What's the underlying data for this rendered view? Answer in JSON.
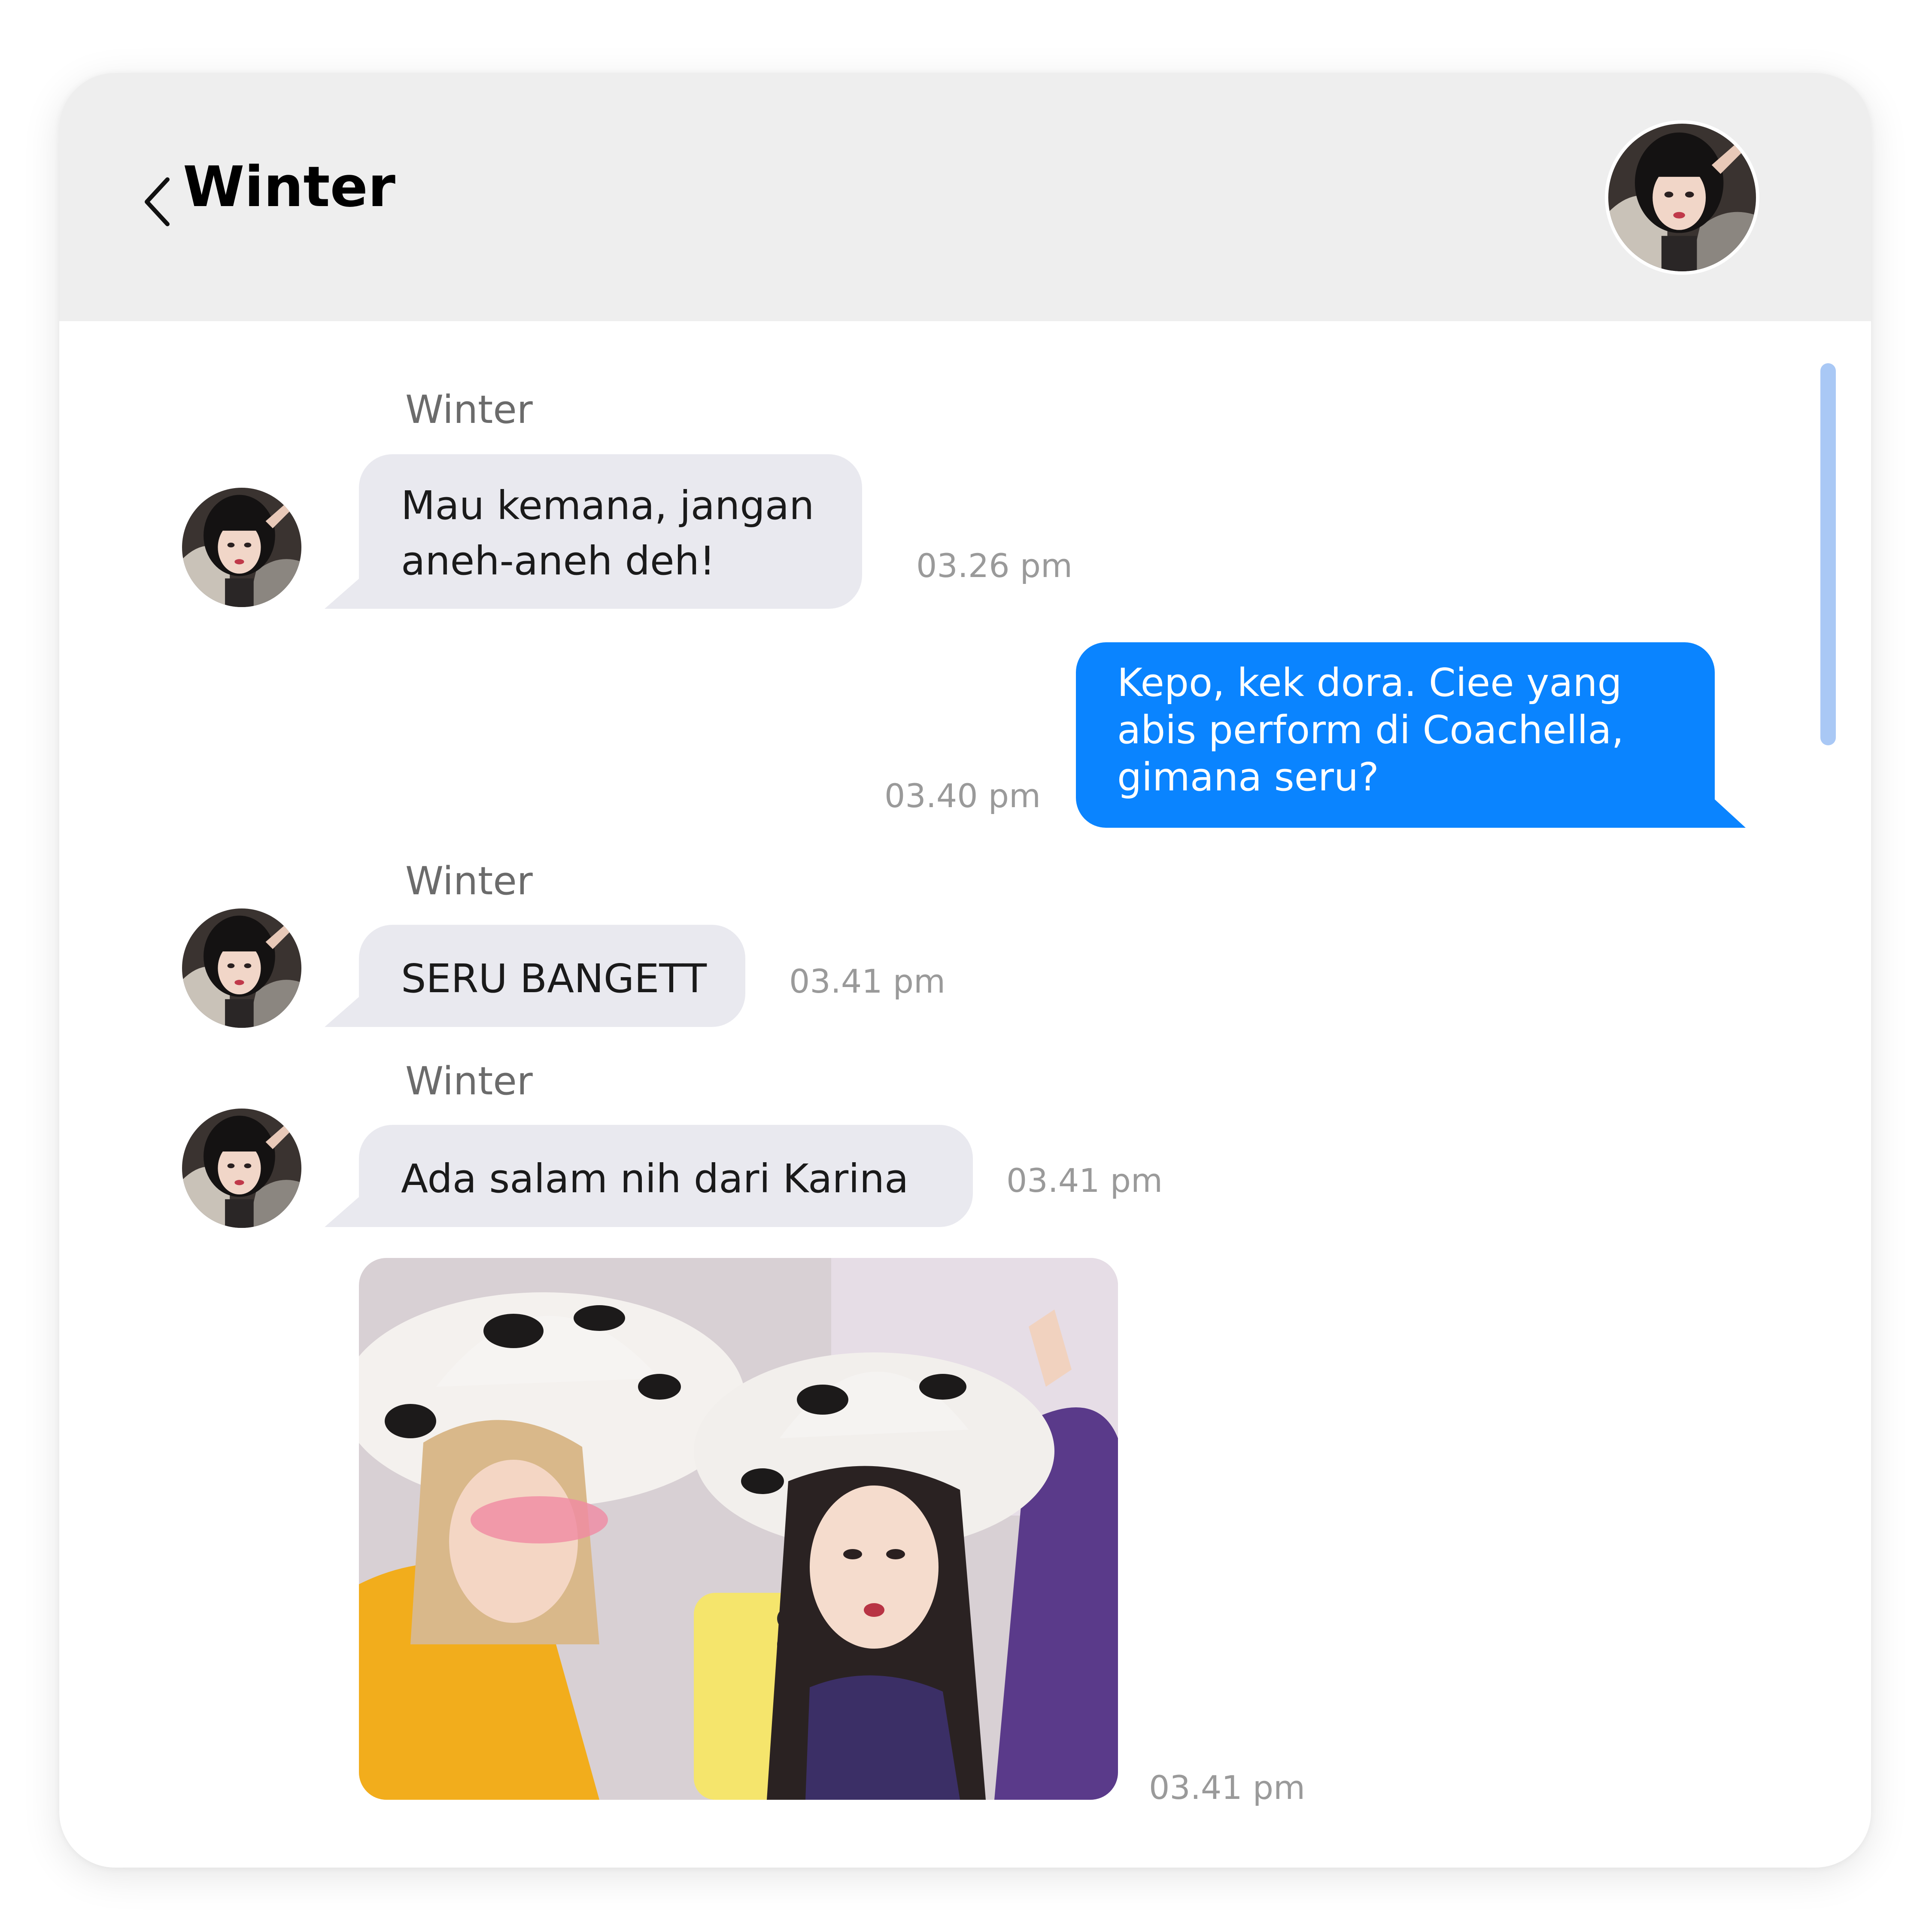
{
  "header": {
    "back_icon": "chevron-left-icon",
    "title": "Winter",
    "avatar": "contact-avatar"
  },
  "messages": [
    {
      "direction": "incoming",
      "sender": "Winter",
      "lines": [
        "Mau kemana, jangan",
        "aneh-aneh deh!"
      ],
      "time": "03.26 pm"
    },
    {
      "direction": "outgoing",
      "lines": [
        "Kepo, kek dora. Ciee yang",
        "abis perform di Coachella,",
        "gimana seru?"
      ],
      "time": "03.40 pm"
    },
    {
      "direction": "incoming",
      "sender": "Winter",
      "text": "SERU BANGETT",
      "time": "03.41 pm"
    },
    {
      "direction": "incoming",
      "sender": "Winter",
      "text": "Ada salam nih dari Karina",
      "time": "03.41 pm"
    },
    {
      "direction": "incoming",
      "type": "image",
      "image": "photo-attachment",
      "time": "03.41 pm"
    }
  ],
  "colors": {
    "header_bg": "#eeeeee",
    "incoming_bubble": "#e9e9ef",
    "outgoing_bubble": "#0a84ff",
    "timestamp": "#9a9a9a",
    "scrollbar": "#a9c8f5"
  }
}
